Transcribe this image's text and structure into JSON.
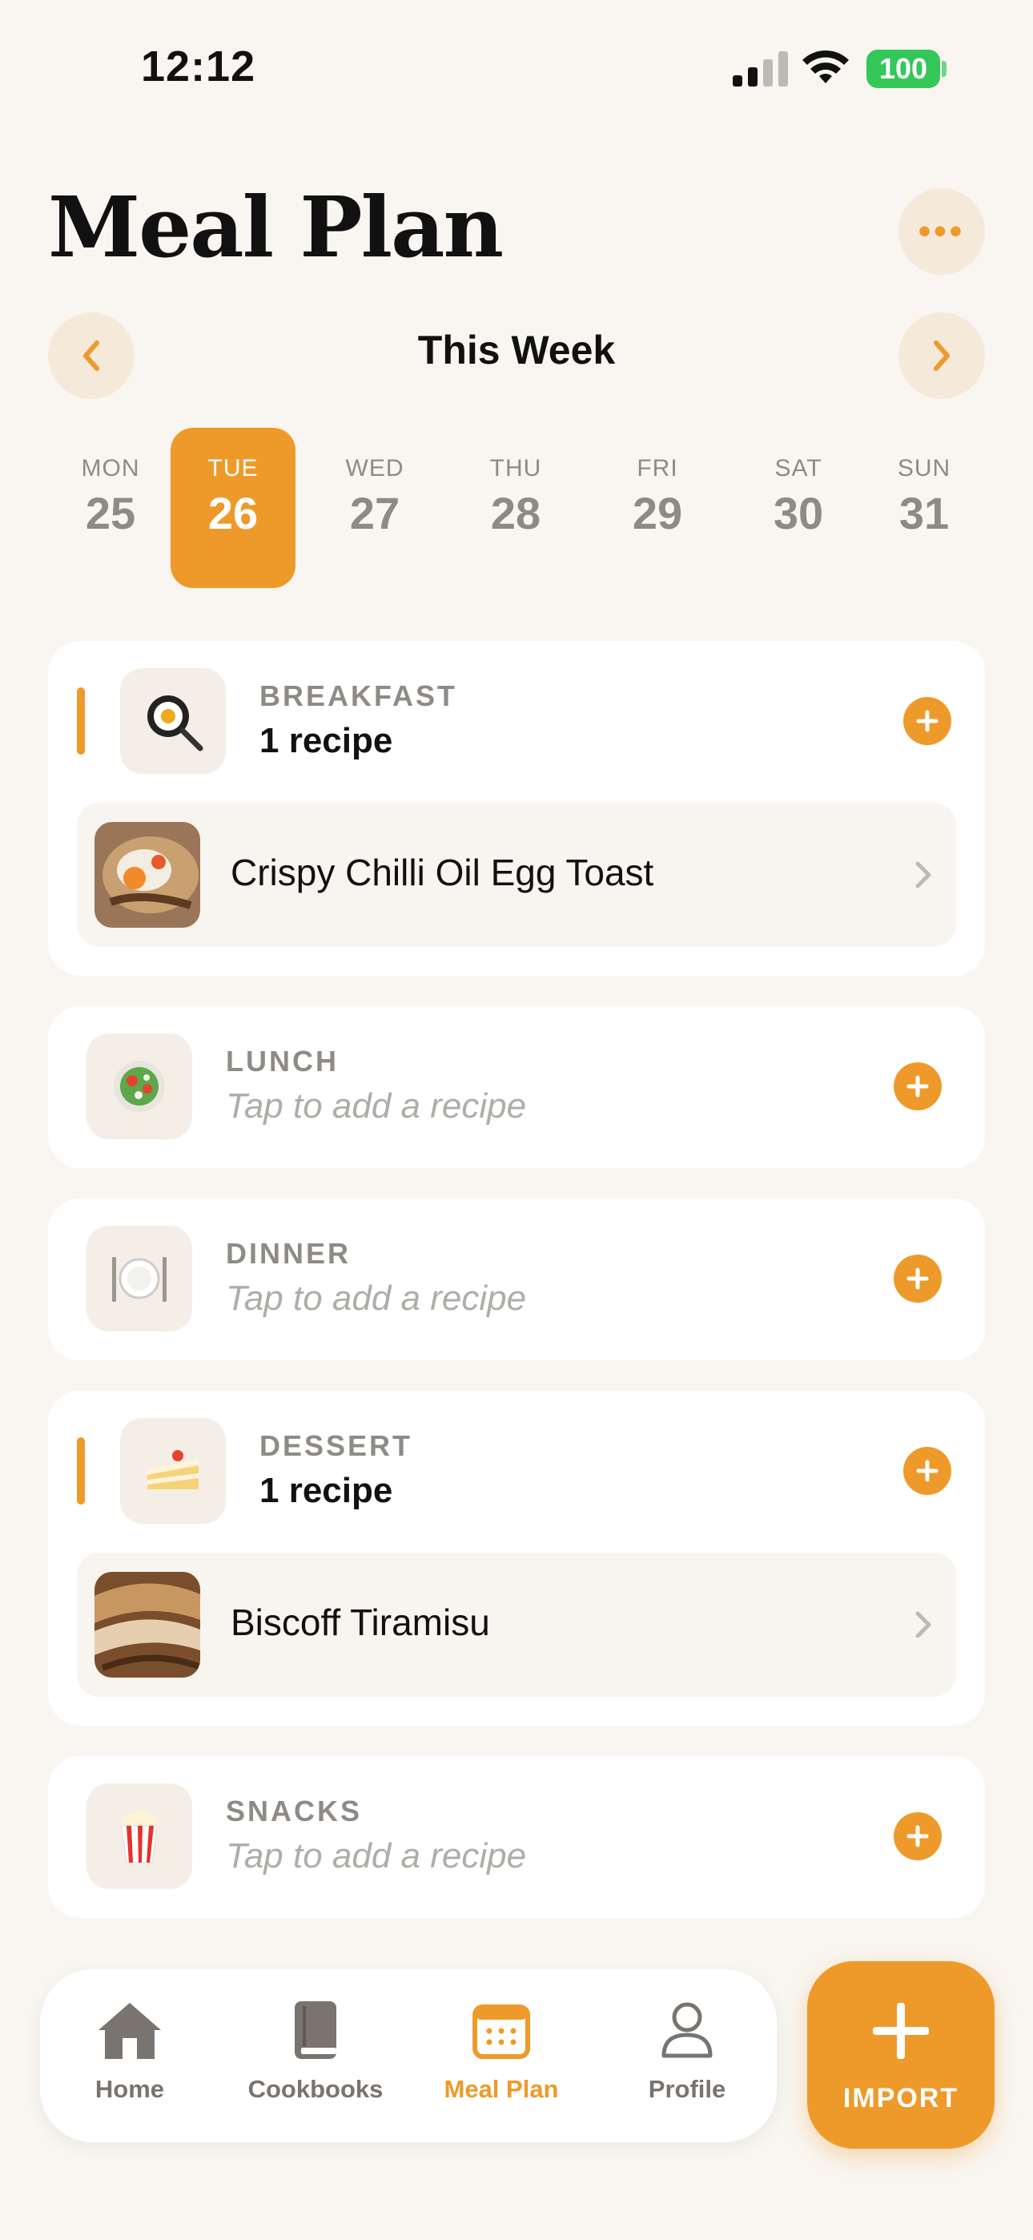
{
  "status_bar": {
    "time": "12:12",
    "battery": "100"
  },
  "header": {
    "title": "Meal Plan",
    "week_label": "This Week"
  },
  "days": [
    {
      "name": "MON",
      "num": "25"
    },
    {
      "name": "TUE",
      "num": "26"
    },
    {
      "name": "WED",
      "num": "27"
    },
    {
      "name": "THU",
      "num": "28"
    },
    {
      "name": "FRI",
      "num": "29"
    },
    {
      "name": "SAT",
      "num": "30"
    },
    {
      "name": "SUN",
      "num": "31"
    }
  ],
  "selected_day": "TUE",
  "meals": {
    "breakfast": {
      "label": "BREAKFAST",
      "sub": "1 recipe",
      "recipe": "Crispy Chilli Oil Egg Toast"
    },
    "lunch": {
      "label": "LUNCH",
      "empty": "Tap to add a recipe"
    },
    "dinner": {
      "label": "DINNER",
      "empty": "Tap to add a recipe"
    },
    "dessert": {
      "label": "DESSERT",
      "sub": "1 recipe",
      "recipe": "Biscoff Tiramisu"
    },
    "snacks": {
      "label": "SNACKS",
      "empty": "Tap to add a recipe"
    }
  },
  "tabbar": {
    "home": "Home",
    "cookbooks": "Cookbooks",
    "meal_plan": "Meal Plan",
    "profile": "Profile",
    "import": "IMPORT"
  },
  "colors": {
    "accent": "#EE9A2A",
    "background": "#F9F6F1",
    "muted": "#8E8B87"
  }
}
